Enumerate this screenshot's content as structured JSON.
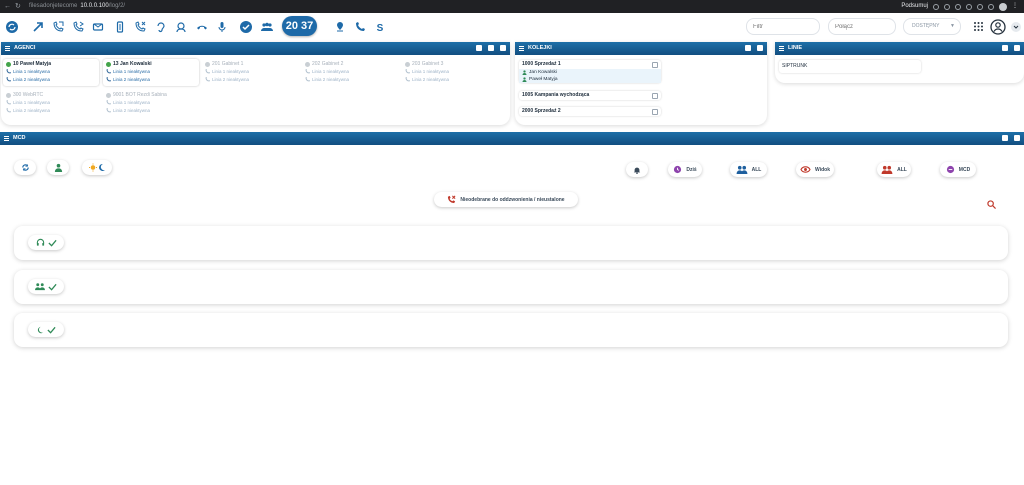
{
  "browser": {
    "url_host": "filesadonjetecome",
    "url_ip": "10.0.0.100",
    "url_path": "/log/2/",
    "right_label": "Podsumuj"
  },
  "header": {
    "clock": "20 37",
    "search_placeholder": "Filtr",
    "call_placeholder": "Połącz",
    "status_value": "DOSTĘPNY"
  },
  "agents_panel": {
    "title": "AGENCI",
    "agents": [
      {
        "name": "10 Paweł Matyja",
        "line1": "Linia 1 nieaktywna",
        "line2": "Linia 2 nieaktywna",
        "dim": false
      },
      {
        "name": "13 Jan Kowalski",
        "line1": "Linia 1 nieaktywna",
        "line2": "Linia 2 nieaktywna",
        "dim": false
      },
      {
        "name": "201 Gabinet 1",
        "line1": "Linia 1 nieaktywna",
        "line2": "Linia 2 nieaktywna",
        "dim": true
      },
      {
        "name": "202 Gabinet 2",
        "line1": "Linia 1 nieaktywna",
        "line2": "Linia 2 nieaktywna",
        "dim": true
      },
      {
        "name": "203 Gabinet 3",
        "line1": "Linia 1 nieaktywna",
        "line2": "Linia 2 nieaktywna",
        "dim": true
      },
      {
        "name": "300 WebRTC",
        "line1": "Linia 1 nieaktywna",
        "line2": "Linia 2 nieaktywna",
        "dim": true
      },
      {
        "name": "9001 BOT Rezdi Sabina",
        "line1": "Linia 1 nieaktywna",
        "line2": "Linia 2 nieaktywna",
        "dim": true
      }
    ]
  },
  "queues_panel": {
    "title": "KOLEJKI",
    "queues": [
      {
        "name": "1000 Sprzedaż 1",
        "members": [
          "Jan Kowalski",
          "Paweł Matyja"
        ]
      },
      {
        "name": "1005 Kampania wychodząca",
        "members": []
      },
      {
        "name": "2000 Sprzedaż 2",
        "members": []
      }
    ]
  },
  "lines_panel": {
    "title": "LINIE",
    "items": [
      "SIPTRUNK"
    ]
  },
  "mcd_panel": {
    "title": "MCD",
    "filter_buttons": [
      {
        "icon": "user-clock-icon",
        "label": "Dziś"
      },
      {
        "icon": "users-icon",
        "label": "ALL"
      },
      {
        "icon": "eye-icon",
        "label": "Widok"
      },
      {
        "icon": "users-icon",
        "label": "ALL"
      },
      {
        "icon": "tag-icon",
        "label": "MCD"
      }
    ],
    "missed_label": "Nieodebrane do oddzwonienia / nieustalone",
    "sections": [
      {
        "icon": "headset-icon"
      },
      {
        "icon": "group-icon"
      },
      {
        "icon": "moon-icon"
      }
    ]
  },
  "colors": {
    "brand": "#1e6aa8",
    "panel_header": "#124e80",
    "available": "#43a34a"
  }
}
